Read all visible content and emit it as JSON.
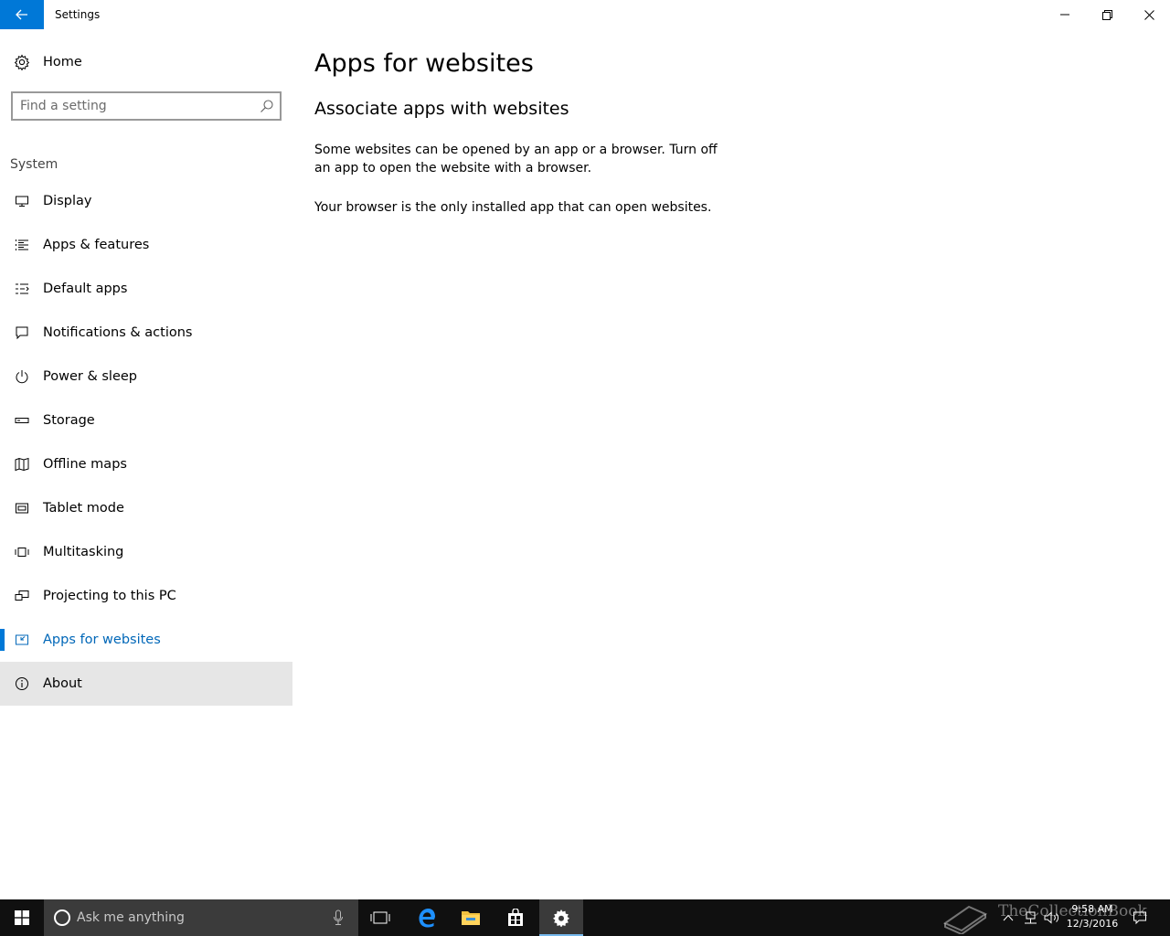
{
  "window": {
    "title": "Settings",
    "controls": {
      "minimize": "minimize-icon",
      "maximize": "restore-icon",
      "close": "close-icon"
    }
  },
  "sidebar": {
    "home_label": "Home",
    "search_placeholder": "Find a setting",
    "section": "System",
    "items": [
      {
        "label": "Display",
        "icon": "display-icon"
      },
      {
        "label": "Apps & features",
        "icon": "apps-list-icon"
      },
      {
        "label": "Default apps",
        "icon": "default-apps-icon"
      },
      {
        "label": "Notifications & actions",
        "icon": "notification-icon"
      },
      {
        "label": "Power & sleep",
        "icon": "power-icon"
      },
      {
        "label": "Storage",
        "icon": "storage-icon"
      },
      {
        "label": "Offline maps",
        "icon": "map-icon"
      },
      {
        "label": "Tablet mode",
        "icon": "tablet-icon"
      },
      {
        "label": "Multitasking",
        "icon": "multitasking-icon"
      },
      {
        "label": "Projecting to this PC",
        "icon": "projecting-icon"
      },
      {
        "label": "Apps for websites",
        "icon": "apps-websites-icon",
        "selected": true
      },
      {
        "label": "About",
        "icon": "info-icon"
      }
    ]
  },
  "main": {
    "title": "Apps for websites",
    "subtitle": "Associate apps with websites",
    "description": "Some websites can be opened by an app or a browser.  Turn off an app to open the website with a browser.",
    "note": "Your browser is the only installed app that can open websites."
  },
  "taskbar": {
    "search_placeholder": "Ask me anything",
    "time": "9:58 AM",
    "date": "12/3/2016",
    "watermark": "TheCollectionBook"
  },
  "colors": {
    "accent": "#0078d7",
    "selected_text": "#0067b8",
    "hover_bg": "#e6e6e6",
    "taskbar_bg": "#101010"
  }
}
